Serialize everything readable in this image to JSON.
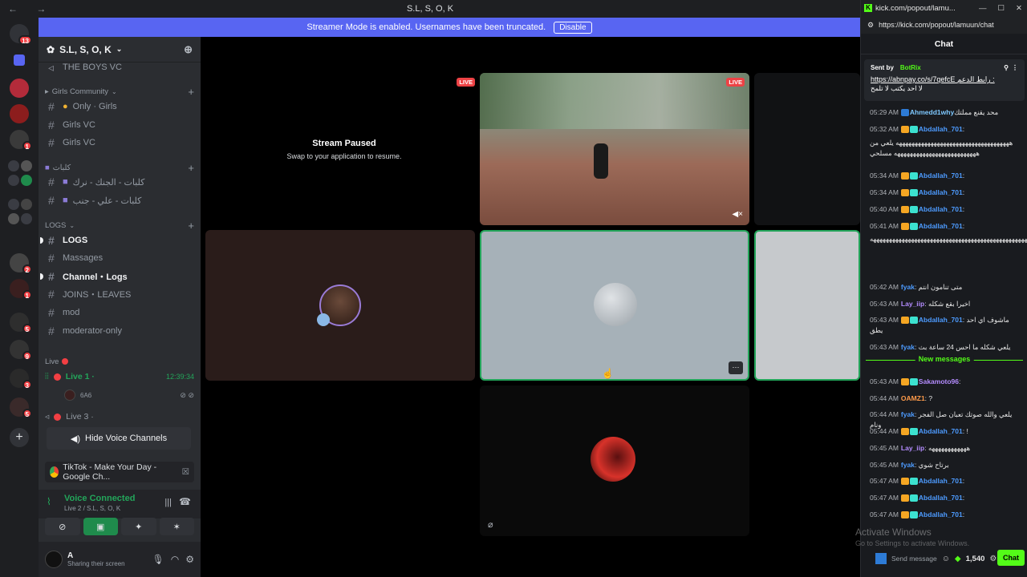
{
  "window": {
    "title": "S.L, S, O, K",
    "nav": "← →"
  },
  "streamer_bar": {
    "message": "Streamer Mode is enabled. Usernames have been truncated.",
    "disable_label": "Disable"
  },
  "server_rail": {
    "badges": [
      "13",
      "1",
      "2",
      "1",
      "5",
      "9",
      "3",
      "5"
    ]
  },
  "guild": {
    "name": "S.L, S, O, K",
    "dropdown_icon": "chevron-down-icon"
  },
  "channels": {
    "the_boys_vc": "THE BOYS VC",
    "girls_community": "Girls Community",
    "only_girls": "Only · Girls",
    "girls_vc_1": "Girls VC",
    "girls_vc_2": "Girls VC",
    "arabic_cat": "كلبات",
    "arabic_ch_1": "كلبات - الجنك - نرك",
    "arabic_ch_2": "كلبات - علي - جنب",
    "logs_cat": "LOGS",
    "logs": "LOGS",
    "massages": "Massages",
    "channel_logs": "Channel・Logs",
    "joins_leaves": "JOINS・LEAVES",
    "mod": "mod",
    "moderator_only": "moderator-only",
    "live_cat": "Live",
    "live_1": "Live 1 ·",
    "live_1_time": "12:39:34",
    "live_1_user": "6A6",
    "live_3": "Live 3 ·"
  },
  "hide_voice_channels": "Hide Voice Channels",
  "tiktok_activity": "TikTok - Make Your Day - Google Ch...",
  "voice_connected": {
    "status": "Voice Connected",
    "location": "Live 2 / S.L, S, O, K"
  },
  "user": {
    "name": "A",
    "status": "Sharing their screen"
  },
  "stage": {
    "paused_title": "Stream Paused",
    "paused_sub": "Swap to your application to resume.",
    "live_label": "LIVE",
    "more_label": "···"
  },
  "chat": {
    "url_short": "kick.com/popout/lamu...",
    "url_full": "https://kick.com/popout/lamuun/chat",
    "header": "Chat",
    "pinned": {
      "sent_by": "Sent by",
      "bot": "BotRix",
      "link": "https://abnpay.co/s/7qefcE",
      "text_1": "رابط الدعم :",
      "text_2": "لا احد يكتب لا تلمح"
    },
    "new_messages": "New messages",
    "messages": [
      {
        "time": "05:29 AM",
        "user": "Ahmedd1why",
        "color": "#7ec8ff",
        "badges": [
          "blue"
        ],
        "text": "محد يقنع مملتك"
      },
      {
        "time": "05:32 AM",
        "user": "Abdallah_701",
        "color": "#4d9bff",
        "badges": [
          "gold",
          "teal"
        ],
        "text": ":"
      },
      {
        "time": "",
        "user": "",
        "color": "#e6e6e6",
        "badges": [],
        "text": "ههههههههههههههههههههههههههههههههههههه يلعي من ههههههههههههههههههههههههههه مسلحي"
      },
      {
        "time": "05:34 AM",
        "user": "Abdallah_701",
        "color": "#4d9bff",
        "badges": [
          "gold",
          "teal"
        ],
        "text": ":"
      },
      {
        "time": "05:34 AM",
        "user": "Abdallah_701",
        "color": "#4d9bff",
        "badges": [
          "gold",
          "teal"
        ],
        "text": ":"
      },
      {
        "time": "05:40 AM",
        "user": "Abdallah_701",
        "color": "#4d9bff",
        "badges": [
          "gold",
          "teal"
        ],
        "text": ":"
      },
      {
        "time": "05:41 AM",
        "user": "Abdallah_701",
        "color": "#4d9bff",
        "badges": [
          "gold",
          "teal"
        ],
        "text": ":"
      },
      {
        "time": "",
        "user": "",
        "color": "#e6e6e6",
        "badges": [],
        "text": "ههههههههههههههههههههههههههههههههههههههههههههههههههههههههههههههههههههههههههههه"
      },
      {
        "time": "05:42 AM",
        "user": "fyak",
        "color": "#4d9bff",
        "badges": [],
        "text": ": متى تنامون انتم"
      },
      {
        "time": "05:43 AM",
        "user": "Lay_iip",
        "color": "#b48cff",
        "badges": [],
        "text": ": اخيرا بقع شكله"
      },
      {
        "time": "05:43 AM",
        "user": "Abdallah_701",
        "color": "#4d9bff",
        "badges": [
          "gold",
          "teal"
        ],
        "text": ": ماشوف اي احد يطق"
      },
      {
        "time": "05:43 AM",
        "user": "fyak",
        "color": "#4d9bff",
        "badges": [],
        "text": ": يلعي شكله ما احس 24 ساعة بث"
      },
      {
        "time": "05:43 AM",
        "user": "Sakamoto96",
        "color": "#b48cff",
        "badges": [
          "gold",
          "teal"
        ],
        "text": ":"
      },
      {
        "time": "05:44 AM",
        "user": "OAMZ1",
        "color": "#ff9b4a",
        "badges": [],
        "text": ": ?"
      },
      {
        "time": "05:44 AM",
        "user": "fyak",
        "color": "#4d9bff",
        "badges": [],
        "text": ": يلعي والله صوتك تعبان صل الفجر ونام"
      },
      {
        "time": "05:44 AM",
        "user": "Abdallah_701",
        "color": "#4d9bff",
        "badges": [
          "gold",
          "teal"
        ],
        "text": ": !"
      },
      {
        "time": "05:45 AM",
        "user": "Lay_iip",
        "color": "#b48cff",
        "badges": [],
        "text": ": ههههههههههههه"
      },
      {
        "time": "05:45 AM",
        "user": "fyak",
        "color": "#4d9bff",
        "badges": [],
        "text": ": برتاح شوي"
      },
      {
        "time": "05:47 AM",
        "user": "Abdallah_701",
        "color": "#4d9bff",
        "badges": [
          "gold",
          "teal"
        ],
        "text": ":"
      },
      {
        "time": "05:47 AM",
        "user": "Abdallah_701",
        "color": "#4d9bff",
        "badges": [
          "gold",
          "teal"
        ],
        "text": ":"
      },
      {
        "time": "05:47 AM",
        "user": "Abdallah_701",
        "color": "#4d9bff",
        "badges": [
          "gold",
          "teal"
        ],
        "text": ":"
      }
    ],
    "send_placeholder": "Send message",
    "points": "1,540",
    "chat_button": "Chat"
  },
  "watermark": {
    "line1": "Activate Windows",
    "line2": "Go to Settings to activate Windows."
  },
  "colors": {
    "discord_blurple": "#5865f2",
    "kick_green": "#53fc18",
    "live_red": "#ed4245",
    "voice_green": "#23a55a"
  }
}
